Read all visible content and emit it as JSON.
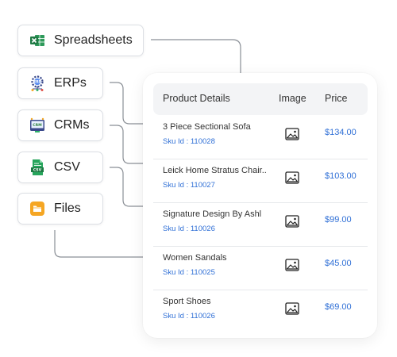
{
  "sources": [
    {
      "label": "Spreadsheets",
      "icon": "excel-icon"
    },
    {
      "label": "ERPs",
      "icon": "erp-gear-icon"
    },
    {
      "label": "CRMs",
      "icon": "crm-icon"
    },
    {
      "label": "CSV",
      "icon": "csv-file-icon"
    },
    {
      "label": "Files",
      "icon": "folder-icon"
    }
  ],
  "table": {
    "headers": {
      "product": "Product Details",
      "image": "Image",
      "price": "Price"
    },
    "rows": [
      {
        "name": "3 Piece Sectional Sofa",
        "sku": "Sku Id : 110028",
        "price": "$134.00"
      },
      {
        "name": "Leick Home Stratus Chair..",
        "sku": "Sku Id : 110027",
        "price": "$103.00"
      },
      {
        "name": "Signature Design By Ashl",
        "sku": "Sku Id : 110026",
        "price": "$99.00"
      },
      {
        "name": "Women Sandals",
        "sku": "Sku Id : 110025",
        "price": "$45.00"
      },
      {
        "name": "Sport Shoes",
        "sku": "Sku Id : 110026",
        "price": "$69.00"
      }
    ]
  },
  "colors": {
    "link_blue": "#2f6fd6",
    "excel_green": "#1f7a44",
    "csv_green": "#27a55c",
    "folder_orange": "#f5a623",
    "connector_gray": "#8a8f96"
  }
}
